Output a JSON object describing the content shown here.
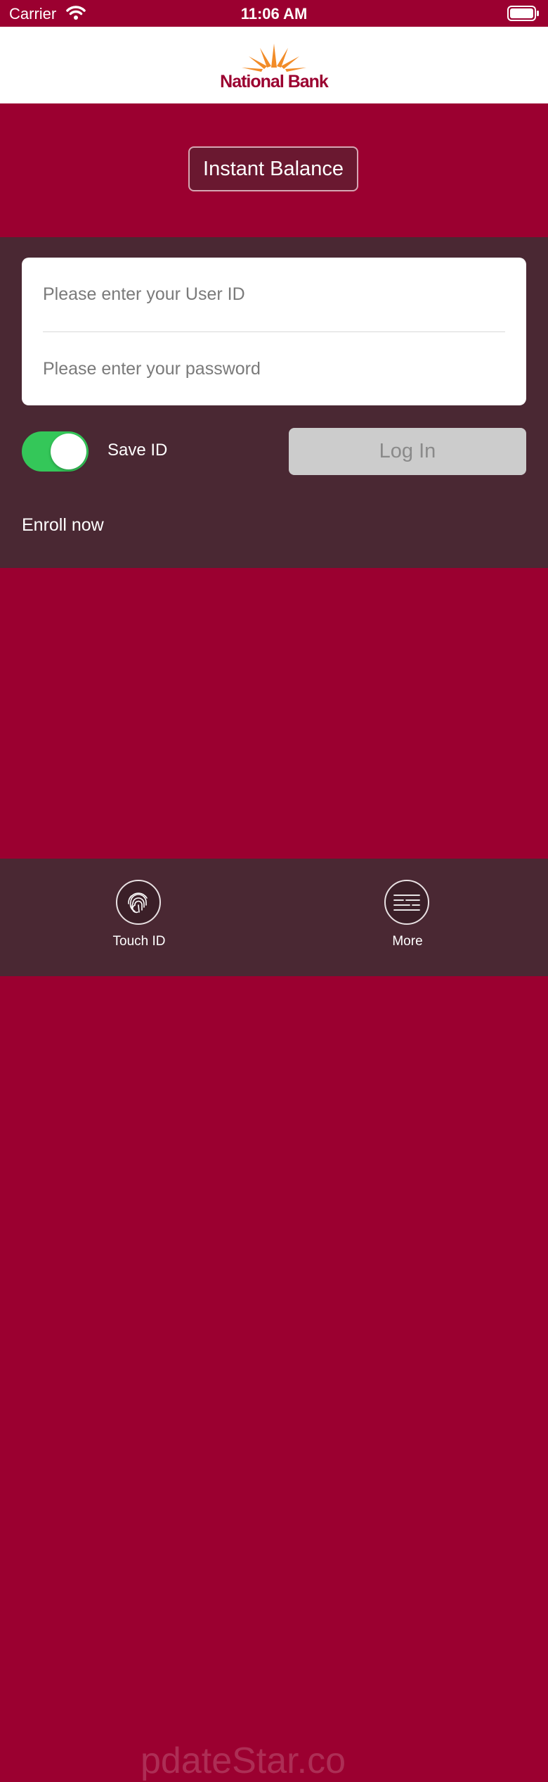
{
  "status_bar": {
    "carrier": "Carrier",
    "time": "11:06 AM"
  },
  "logo": {
    "text": "National Bank"
  },
  "hero": {
    "instant_balance_label": "Instant Balance"
  },
  "login": {
    "user_id_placeholder": "Please enter your User ID",
    "password_placeholder": "Please enter your password",
    "save_id_label": "Save ID",
    "save_id_on": true,
    "login_label": "Log In",
    "enroll_label": "Enroll now"
  },
  "tab_bar": {
    "touch_id_label": "Touch ID",
    "touch_id_icon": "fingerprint-icon",
    "more_label": "More",
    "more_icon": "menu-icon"
  },
  "watermark": "pdateStar.co",
  "colors": {
    "brand": "#9b0030",
    "panel": "#4a2833",
    "toggle_on": "#34c759",
    "logo_orange": "#f28c28"
  }
}
